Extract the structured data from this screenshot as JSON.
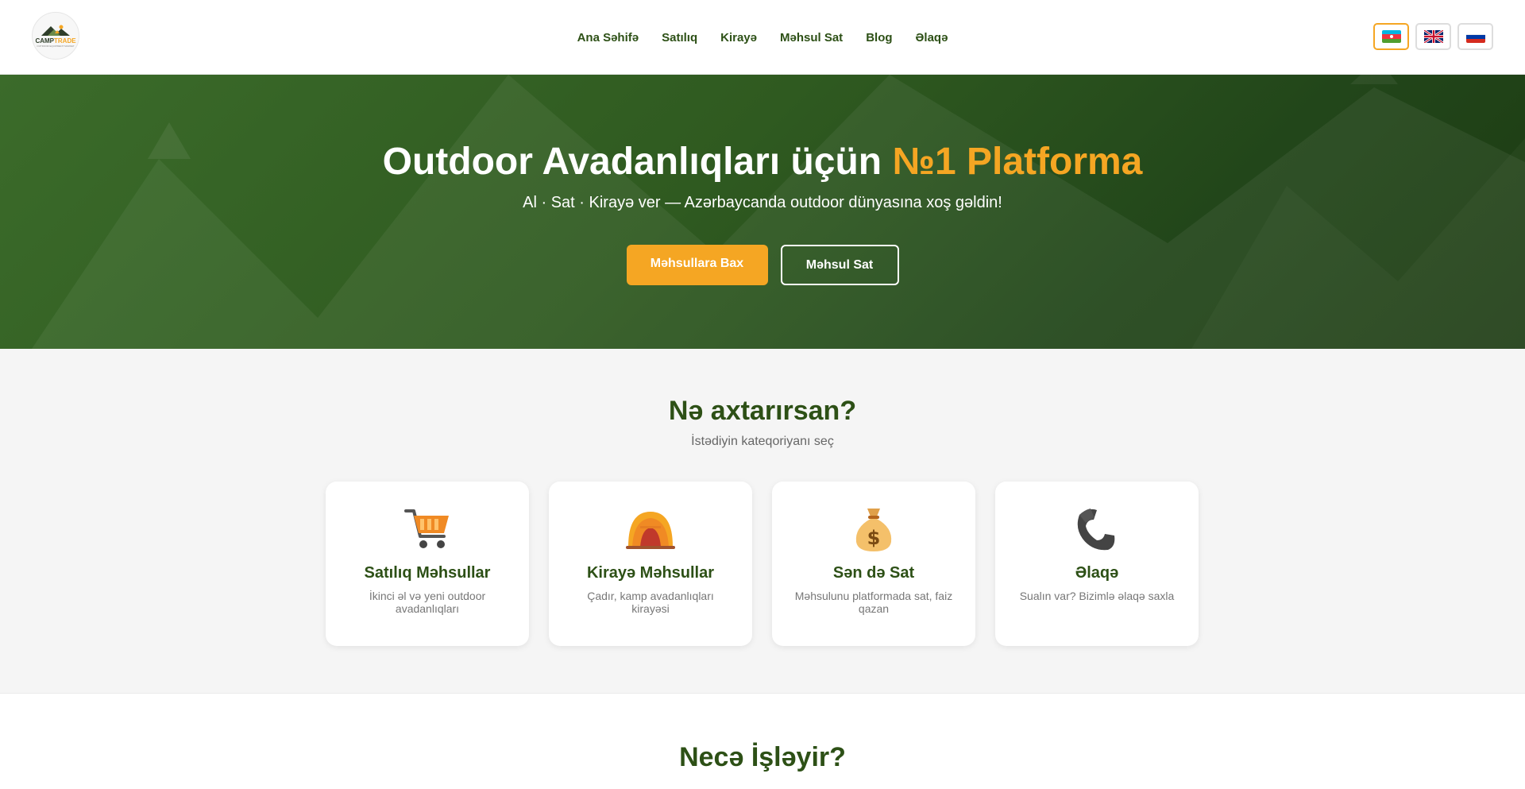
{
  "brand": {
    "name_part1": "CAMP",
    "name_part2": "TRADE",
    "tagline": "OUTDOOR EQUIPMENT MARKET"
  },
  "nav": {
    "items": [
      {
        "label": "Ana Səhifə"
      },
      {
        "label": "Satılıq"
      },
      {
        "label": "Kirayə"
      },
      {
        "label": "Məhsul Sat"
      },
      {
        "label": "Blog"
      },
      {
        "label": "Əlaqə"
      }
    ]
  },
  "languages": {
    "active": "az",
    "items": [
      {
        "code": "az",
        "icon": "flag-az-icon"
      },
      {
        "code": "en",
        "icon": "flag-gb-icon"
      },
      {
        "code": "ru",
        "icon": "flag-ru-icon"
      }
    ]
  },
  "hero": {
    "title_main": "Outdoor Avadanlıqları üçün ",
    "title_accent": "№1 Platforma",
    "subtitle": "Al · Sat · Kirayə ver — Azərbaycanda outdoor dünyasına xoş gəldin!",
    "primary_button": "Məhsullara Bax",
    "secondary_button": "Məhsul Sat"
  },
  "categories": {
    "title": "Nə axtarırsan?",
    "subtitle": "İstədiyin kateqoriyanı seç",
    "cards": [
      {
        "icon": "shopping-cart-icon",
        "title": "Satılıq Məhsullar",
        "desc": "İkinci əl və yeni outdoor avadanlıqları"
      },
      {
        "icon": "tent-icon",
        "title": "Kirayə Məhsullar",
        "desc": "Çadır, kamp avadanlıqları kirayəsi"
      },
      {
        "icon": "money-bag-icon",
        "title": "Sən də Sat",
        "desc": "Məhsulunu platformada sat, faiz qazan"
      },
      {
        "icon": "phone-icon",
        "title": "Əlaqə",
        "desc": "Sualın var? Bizimlə əlaqə saxla"
      }
    ]
  },
  "how": {
    "title": "Necə İşləyir?"
  },
  "colors": {
    "brand_green": "#2d5016",
    "accent": "#f5a623",
    "hero_dark": "#1c3b12"
  }
}
